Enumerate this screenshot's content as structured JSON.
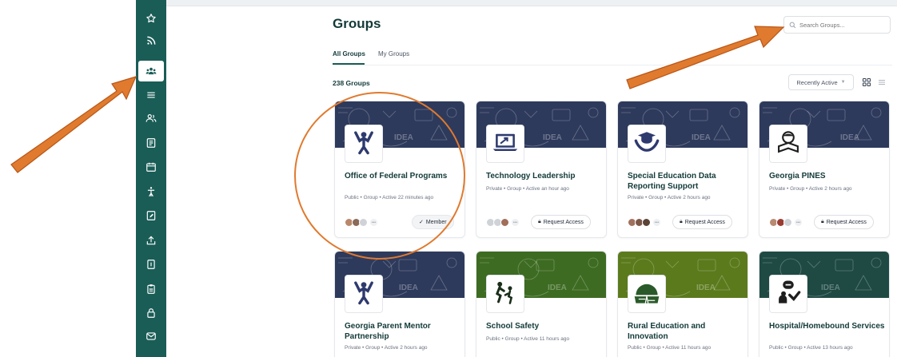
{
  "page": {
    "title": "Groups",
    "search_placeholder": "Search Groups...",
    "tabs": [
      {
        "label": "All Groups",
        "active": true
      },
      {
        "label": "My Groups",
        "active": false
      }
    ],
    "group_count": "238 Groups",
    "sort_label": "Recently Active"
  },
  "sidebar": {
    "items": [
      {
        "icon": "star-icon"
      },
      {
        "icon": "rss-icon"
      },
      {
        "icon": "groups-icon",
        "active": true
      },
      {
        "icon": "menu-icon"
      },
      {
        "icon": "people-icon"
      },
      {
        "icon": "document-icon"
      },
      {
        "icon": "calendar-icon"
      },
      {
        "icon": "accessibility-icon"
      },
      {
        "icon": "edit-note-icon"
      },
      {
        "icon": "upload-icon"
      },
      {
        "icon": "book-icon"
      },
      {
        "icon": "clipboard-icon"
      },
      {
        "icon": "lock-icon"
      },
      {
        "icon": "mail-icon"
      }
    ]
  },
  "groups": [
    {
      "name": "Office of Federal Programs",
      "meta": "Public • Group • Active 22 minutes ago",
      "action": "Member",
      "icon": "person-celebrate-icon",
      "cover": "#2e3a5c"
    },
    {
      "name": "Technology Leadership",
      "meta": "Private • Group • Active an hour ago",
      "action": "Request Access",
      "icon": "laptop-icon",
      "cover": "#2e3a5c"
    },
    {
      "name": "Special Education Data Reporting Support",
      "meta": "Private • Group • Active 2 hours ago",
      "action": "Request Access",
      "icon": "graduate-hands-icon",
      "cover": "#2e3a5c"
    },
    {
      "name": "Georgia PINES",
      "meta": "Private • Group • Active 2 hours ago",
      "action": "Request Access",
      "icon": "reader-icon",
      "cover": "#2e3a5c"
    },
    {
      "name": "Georgia Parent Mentor Partnership",
      "meta": "Private • Group • Active 2 hours ago",
      "action": "",
      "icon": "person-celebrate-icon",
      "cover": "#2e3a5c"
    },
    {
      "name": "School Safety",
      "meta": "Public • Group • Active 11 hours ago",
      "action": "",
      "icon": "crossing-icon",
      "cover": "#3d6b22"
    },
    {
      "name": "Rural Education and Innovation",
      "meta": "Public • Group • Active 11 hours ago",
      "action": "",
      "icon": "road-icon",
      "cover": "#5b7a1c"
    },
    {
      "name": "Hospital/Homebound Services",
      "meta": "Public • Group • Active 13 hours ago",
      "action": "",
      "icon": "patient-icon",
      "cover": "#1f4a44"
    }
  ],
  "colors": {
    "sidebar": "#1a5d57",
    "title": "#133a39",
    "annotation": "#e07a2e"
  }
}
